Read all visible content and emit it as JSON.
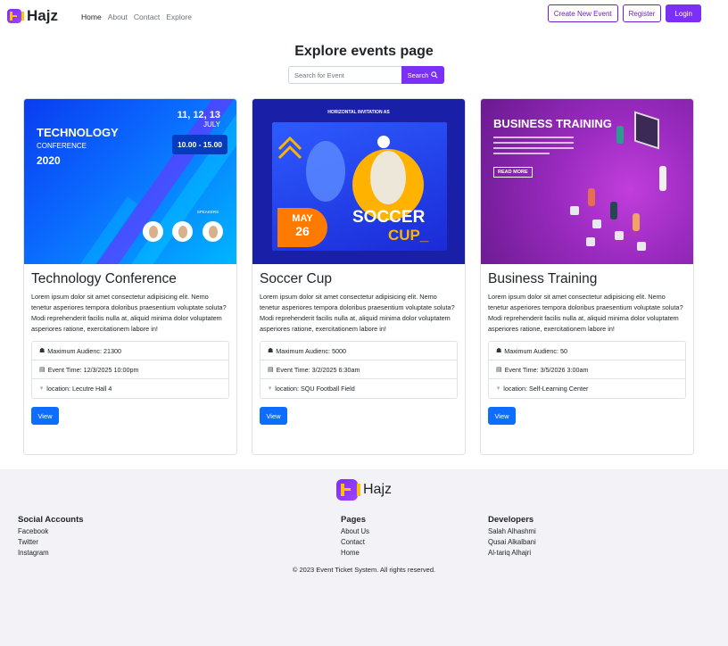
{
  "nav": {
    "brand": "Hajz",
    "links": [
      "Home",
      "About",
      "Contact",
      "Explore"
    ],
    "create_event": "Create New Event",
    "register": "Register",
    "login": "Login"
  },
  "header": {
    "title": "Explore events page",
    "search_placeholder": "Search for Event",
    "search_button": "Search"
  },
  "events": [
    {
      "title": "Technology Conference",
      "description": "Lorem ipsum dolor sit amet consectetur adipisicing elit. Nemo tenetur asperiores tempora doloribus praesentium voluptate soluta? Modi reprehenderit facilis nulla at, aliquid minima dolor voluptatem asperiores ratione, exercitationem labore in!",
      "audience": "Maximum Audienc: 21300",
      "time": "Event Time: 12/3/2025 10:00pm",
      "location": "location: Lecutre Hall 4",
      "view": "View",
      "image": {
        "line1": "TECHNOLOGY",
        "line2": "CONFERENCE",
        "line3": "2020",
        "dates": "11, 12, 13",
        "month": "JULY",
        "time": "10.00 - 15.00",
        "speakers": "SPEAKERS"
      }
    },
    {
      "title": "Soccer Cup",
      "description": "Lorem ipsum dolor sit amet consectetur adipisicing elit. Nemo tenetur asperiores tempora doloribus praesentium voluptate soluta? Modi reprehenderit facilis nulla at, aliquid minima dolor voluptatem asperiores ratione, exercitationem labore in!",
      "audience": "Maximum Audienc: 5000",
      "time": "Event Time: 3/2/2025 6:30am",
      "location": "location: SQU Football Field",
      "view": "View",
      "image": {
        "heading": "HORIZONTAL INVITATION AS",
        "may": "MAY",
        "day": "26",
        "soccer": "SOCCER",
        "cup": "CUP_"
      }
    },
    {
      "title": "Business Training",
      "description": "Lorem ipsum dolor sit amet consectetur adipisicing elit. Nemo tenetur asperiores tempora doloribus praesentium voluptate soluta? Modi reprehenderit facilis nulla at, aliquid minima dolor voluptatem asperiores ratione, exercitationem labore in!",
      "audience": "Maximum Audienc: 50",
      "time": "Event Time: 3/5/2026 3:00am",
      "location": "location: Self-Learning Center",
      "view": "View",
      "image": {
        "heading": "BUSINESS TRAINING",
        "read_more": "READ MORE"
      }
    }
  ],
  "footer": {
    "brand": "Hajz",
    "social": {
      "title": "Social Accounts",
      "links": [
        "Facebook",
        "Twitter",
        "Instagram"
      ]
    },
    "pages": {
      "title": "Pages",
      "links": [
        "About Us",
        "Contact",
        "Home"
      ]
    },
    "developers": {
      "title": "Developers",
      "names": [
        "Salah Alhashmi",
        "Qusai Alkalbani",
        "Al-tariq Alhajri"
      ]
    },
    "copyright": "© 2023 Event Ticket System. All rights reserved."
  },
  "colors": {
    "brand": "#7b2ff7",
    "primary": "#0d6efd",
    "footer_bg": "#f3f2f7"
  }
}
